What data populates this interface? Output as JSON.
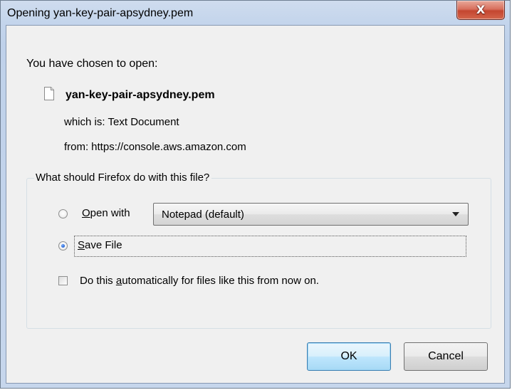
{
  "window": {
    "title": "Opening yan-key-pair-apsydney.pem",
    "close_icon": "close-x-icon",
    "close_label": "X"
  },
  "dialog": {
    "heading": "You have chosen to open:",
    "file_icon": "text-file-icon",
    "filename": "yan-key-pair-apsydney.pem",
    "which_is_label": "which is:",
    "which_is_value": "Text Document",
    "from_label": "from:",
    "from_value": "https://console.aws.amazon.com"
  },
  "action_group": {
    "legend": "What should Firefox do with this file?",
    "open_with": {
      "mnemonic": "O",
      "label_rest": "pen with",
      "selected": false
    },
    "app_select": {
      "value": "Notepad (default)",
      "arrow_icon": "dropdown-arrow-icon"
    },
    "save_file": {
      "mnemonic": "S",
      "label_rest": "ave File",
      "selected": true
    },
    "auto_checkbox": {
      "label_before": "Do this ",
      "mnemonic": "a",
      "label_after": "utomatically for files like this from now on.",
      "checked": false
    }
  },
  "buttons": {
    "ok": "OK",
    "cancel": "Cancel"
  },
  "colors": {
    "titlebar": "#c4d5ec",
    "client_bg": "#f0f0f0",
    "close_button": "#c44630",
    "default_button_border": "#3c7fb1"
  }
}
